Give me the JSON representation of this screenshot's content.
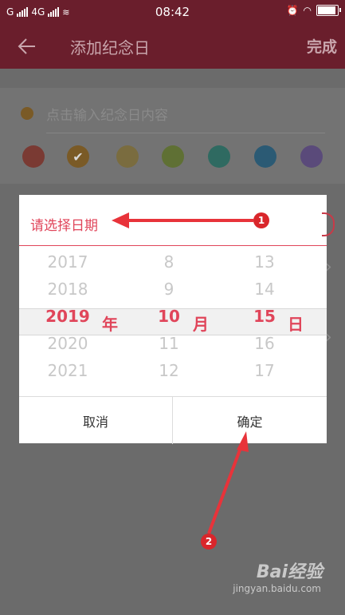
{
  "status_bar": {
    "carrier1": "G",
    "carrier2": "4G",
    "time": "08:42",
    "battery_level": 0.9
  },
  "app_bar": {
    "title": "添加纪念日",
    "done_label": "完成"
  },
  "form": {
    "content_placeholder": "点击输入纪念日内容",
    "colors": [
      "#7a3a33",
      "#7a5a26",
      "#7a6c3f",
      "#5f7034",
      "#2f6a61",
      "#2b5a74",
      "#5a4a7a"
    ],
    "selected_color_index": 1
  },
  "dialog": {
    "title": "请选择日期",
    "years": [
      "2017",
      "2018",
      "2019",
      "2020",
      "2021"
    ],
    "months": [
      "8",
      "9",
      "10",
      "11",
      "12"
    ],
    "days": [
      "13",
      "14",
      "15",
      "16",
      "17"
    ],
    "selected_index": 2,
    "year_unit": "年",
    "month_unit": "月",
    "day_unit": "日",
    "cancel_label": "取消",
    "ok_label": "确定"
  },
  "annotations": {
    "marker1": "1",
    "marker2": "2"
  },
  "watermark": {
    "logo": "Bai经验",
    "url": "jingyan.baidu.com"
  },
  "colors": {
    "accent": "#e0455a",
    "arrow": "#e8333a"
  }
}
